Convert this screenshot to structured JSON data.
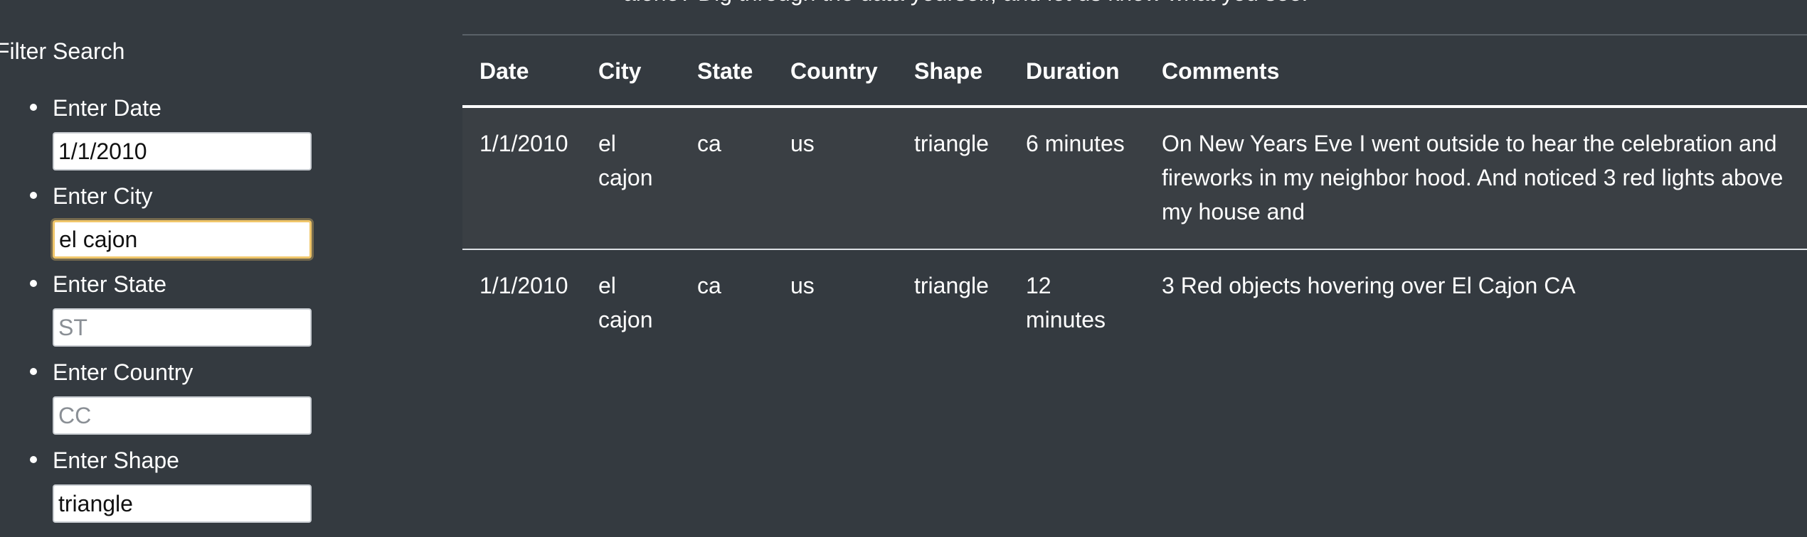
{
  "intro": {
    "text": "alone? Dig through the data yourself, and let us know what you see."
  },
  "filters": {
    "title": "Filter Search",
    "items": [
      {
        "label": "Enter Date",
        "value": "1/1/2010",
        "placeholder": ""
      },
      {
        "label": "Enter City",
        "value": "el cajon",
        "placeholder": ""
      },
      {
        "label": "Enter State",
        "value": "",
        "placeholder": "ST"
      },
      {
        "label": "Enter Country",
        "value": "",
        "placeholder": "CC"
      },
      {
        "label": "Enter Shape",
        "value": "triangle",
        "placeholder": ""
      }
    ]
  },
  "table": {
    "headers": [
      "Date",
      "City",
      "State",
      "Country",
      "Shape",
      "Duration",
      "Comments"
    ],
    "rows": [
      [
        "1/1/2010",
        "el cajon",
        "ca",
        "us",
        "triangle",
        "6 minutes",
        "On New Years Eve I went outside to hear the celebration and fireworks in my neighbor hood. And noticed 3 red lights above my house and"
      ],
      [
        "1/1/2010",
        "el cajon",
        "ca",
        "us",
        "triangle",
        "12 minutes",
        "3 Red objects hovering over El Cajon CA"
      ]
    ]
  },
  "colors": {
    "background": "#343a40",
    "text": "#ffffff",
    "focus_ring": "#f0c66a"
  }
}
